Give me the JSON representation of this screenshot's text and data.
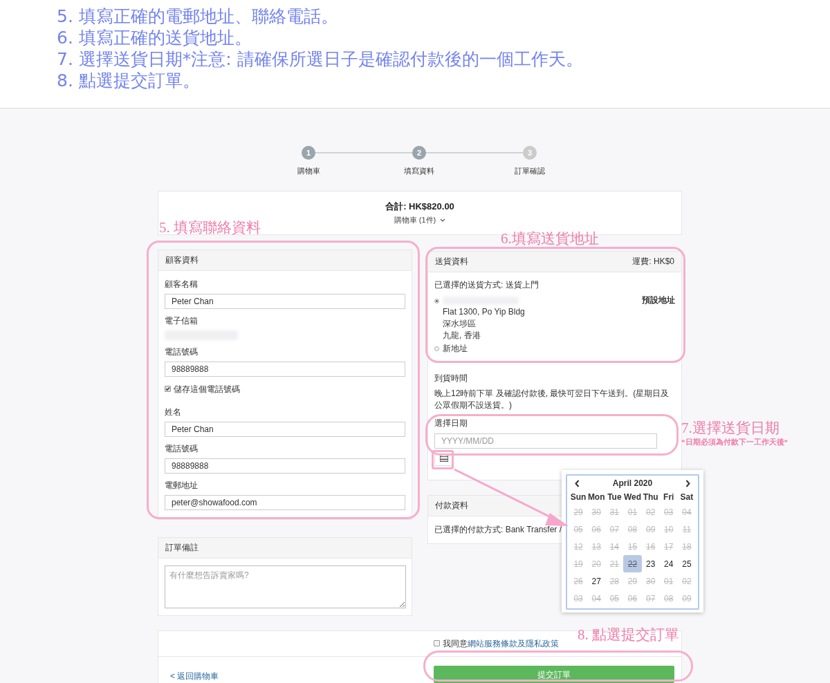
{
  "instructions": [
    "5. 填寫正確的電郵地址、聯絡電話。",
    "6. 填寫正確的送貨地址。",
    "7. 選擇送貨日期*注意: 請確保所選日子是確認付款後的一個工作天。",
    "8. 點選提交訂單。"
  ],
  "steps": [
    {
      "number": "1",
      "label": "購物車",
      "completed": true
    },
    {
      "number": "2",
      "label": "填寫資料",
      "completed": true
    },
    {
      "number": "3",
      "label": "訂單確認",
      "completed": false
    }
  ],
  "summary": {
    "total": "合計: HK$820.00",
    "cart_toggle": "購物車 (1件)"
  },
  "customer": {
    "title": "顧客資料",
    "fields": [
      {
        "kind": "input",
        "label": "顧客名稱",
        "value": "Peter Chan"
      },
      {
        "kind": "blurred",
        "label": "電子信箱"
      },
      {
        "kind": "input",
        "label": "電話號碼",
        "value": "98889888"
      },
      {
        "kind": "checkbox",
        "label": "儲存這個電話號碼",
        "checked": true
      },
      {
        "kind": "input",
        "label": "姓名",
        "value": "Peter Chan"
      },
      {
        "kind": "input",
        "label": "電話號碼",
        "value": "98889888"
      },
      {
        "kind": "input",
        "label": "電郵地址",
        "value": "peter@showafood.com"
      }
    ]
  },
  "notes": {
    "title": "訂單備註",
    "placeholder": "有什麼想告訴賣家嗎?"
  },
  "shipping": {
    "title": "送貨資料",
    "fee": "運費: HK$0",
    "method": "已選擇的送貨方式: 送貨上門",
    "addresses": [
      {
        "selected": true,
        "blurred_name": true,
        "lines": [
          "Flat 1300, Po Yip Bldg",
          "深水埗區",
          "九龍, 香港"
        ],
        "tag": "預設地址"
      },
      {
        "selected": false,
        "blurred_name": false,
        "lines": [
          "新地址"
        ]
      }
    ],
    "delivery_title": "到貨時間",
    "delivery_note": "晚上12時前下單 及確認付款後, 最快可翌日下午送到。(星期日及公眾假期不設送貨。)",
    "date_label": "選擇日期",
    "date_placeholder": "YYYY/MM/DD"
  },
  "payment": {
    "title": "付款資料",
    "method": "已選擇的付款方式: Bank Transfer /"
  },
  "calendar": {
    "month": "April 2020",
    "weekdays": [
      "Sun",
      "Mon",
      "Tue",
      "Wed",
      "Thu",
      "Fri",
      "Sat"
    ],
    "days": [
      {
        "label": "29",
        "disabled": true,
        "selected": false
      },
      {
        "label": "30",
        "disabled": true,
        "selected": false
      },
      {
        "label": "31",
        "disabled": true,
        "selected": false
      },
      {
        "label": "01",
        "disabled": true,
        "selected": false
      },
      {
        "label": "02",
        "disabled": true,
        "selected": false
      },
      {
        "label": "03",
        "disabled": true,
        "selected": false
      },
      {
        "label": "04",
        "disabled": true,
        "selected": false
      },
      {
        "label": "05",
        "disabled": true,
        "selected": false
      },
      {
        "label": "06",
        "disabled": true,
        "selected": false
      },
      {
        "label": "07",
        "disabled": true,
        "selected": false
      },
      {
        "label": "08",
        "disabled": true,
        "selected": false
      },
      {
        "label": "09",
        "disabled": true,
        "selected": false
      },
      {
        "label": "10",
        "disabled": true,
        "selected": false
      },
      {
        "label": "11",
        "disabled": true,
        "selected": false
      },
      {
        "label": "12",
        "disabled": true,
        "selected": false
      },
      {
        "label": "13",
        "disabled": true,
        "selected": false
      },
      {
        "label": "14",
        "disabled": true,
        "selected": false
      },
      {
        "label": "15",
        "disabled": true,
        "selected": false
      },
      {
        "label": "16",
        "disabled": true,
        "selected": false
      },
      {
        "label": "17",
        "disabled": true,
        "selected": false
      },
      {
        "label": "18",
        "disabled": true,
        "selected": false
      },
      {
        "label": "19",
        "disabled": true,
        "selected": false
      },
      {
        "label": "20",
        "disabled": true,
        "selected": false
      },
      {
        "label": "21",
        "disabled": true,
        "selected": false
      },
      {
        "label": "22",
        "disabled": true,
        "selected": true
      },
      {
        "label": "23",
        "disabled": false,
        "selected": false
      },
      {
        "label": "24",
        "disabled": false,
        "selected": false
      },
      {
        "label": "25",
        "disabled": false,
        "selected": false
      },
      {
        "label": "26",
        "disabled": true,
        "selected": false
      },
      {
        "label": "27",
        "disabled": false,
        "selected": false
      },
      {
        "label": "28",
        "disabled": true,
        "selected": false
      },
      {
        "label": "29",
        "disabled": true,
        "selected": false
      },
      {
        "label": "30",
        "disabled": true,
        "selected": false
      },
      {
        "label": "01",
        "disabled": true,
        "selected": false
      },
      {
        "label": "02",
        "disabled": true,
        "selected": false
      },
      {
        "label": "03",
        "disabled": true,
        "selected": false
      },
      {
        "label": "04",
        "disabled": true,
        "selected": false
      },
      {
        "label": "05",
        "disabled": true,
        "selected": false
      },
      {
        "label": "06",
        "disabled": true,
        "selected": false
      },
      {
        "label": "07",
        "disabled": true,
        "selected": false
      },
      {
        "label": "08",
        "disabled": true,
        "selected": false
      },
      {
        "label": "09",
        "disabled": true,
        "selected": false
      }
    ]
  },
  "terms": {
    "checked": false,
    "text": "我同意",
    "link": "網站服務條款及隱私政策"
  },
  "back_link": "< 返回購物車",
  "submit": "提交訂單",
  "callouts": [
    {
      "text": "5. 填寫聯絡資料"
    },
    {
      "text": "6.填寫送貨地址"
    },
    {
      "text": "7.選擇送貨日期",
      "note": "*日期必須為付款下一工作天後*"
    },
    {
      "text": "8. 點選提交訂單"
    }
  ]
}
